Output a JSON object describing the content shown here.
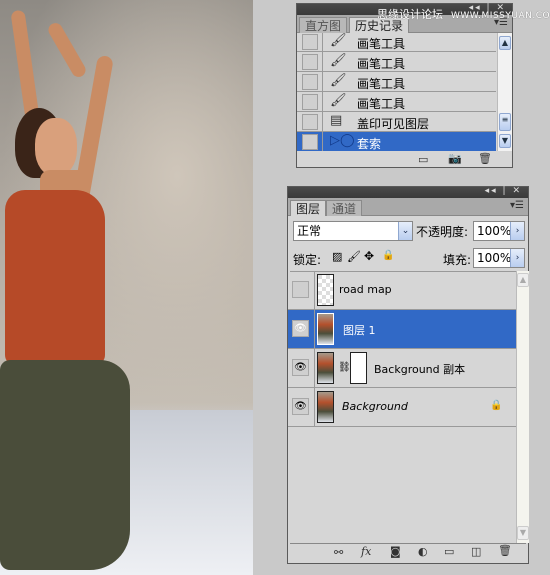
{
  "watermark": {
    "cn": "思缘设计论坛",
    "url": "WWW.MISSYUAN.COM"
  },
  "history_panel": {
    "tabs": [
      {
        "label": "直方图"
      },
      {
        "label": "历史记录"
      }
    ],
    "items": [
      {
        "label": "画笔工具",
        "icon": "brush-icon"
      },
      {
        "label": "画笔工具",
        "icon": "brush-icon"
      },
      {
        "label": "画笔工具",
        "icon": "brush-icon"
      },
      {
        "label": "画笔工具",
        "icon": "brush-icon"
      },
      {
        "label": "盖印可见图层",
        "icon": "document-icon"
      },
      {
        "label": "套索",
        "icon": "lasso-icon",
        "selected": true
      }
    ],
    "footer_icons": [
      "new-document-from-state-icon",
      "new-snapshot-icon",
      "trash-icon"
    ]
  },
  "layers_panel": {
    "tabs": [
      {
        "label": "图层"
      },
      {
        "label": "通道"
      }
    ],
    "blend_mode": "正常",
    "opacity_label": "不透明度:",
    "opacity": "100%",
    "lock_label": "锁定:",
    "fill_label": "填充:",
    "fill": "100%",
    "layers": [
      {
        "name": "road map",
        "visible": false,
        "selected": false
      },
      {
        "name": "图层 1",
        "visible": true,
        "selected": true
      },
      {
        "name": "Background 副本",
        "visible": true,
        "has_mask": true
      },
      {
        "name": "Background",
        "visible": true,
        "locked": true
      }
    ],
    "footer_icons": [
      "link-icon",
      "fx-icon",
      "mask-icon",
      "adjustment-icon",
      "group-icon",
      "new-layer-icon",
      "trash-icon"
    ],
    "accent": "#3169c6"
  }
}
